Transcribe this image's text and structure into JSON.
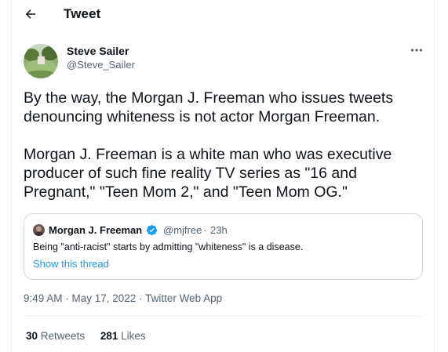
{
  "header": {
    "title": "Tweet",
    "back_icon": "arrow-left-icon"
  },
  "tweet": {
    "author": {
      "name": "Steve Sailer",
      "handle": "@Steve_Sailer",
      "avatar_icon": "avatar-image"
    },
    "more_icon": "more-options-icon",
    "paragraphs": [
      "By the way, the Morgan J. Freeman who issues tweets denouncing whiteness is not actor Morgan Freeman.",
      "Morgan J. Freeman is a white man who was executive producer of such fine reality TV series as \"16 and Pregnant,\" \"Teen Mom 2,\" and \"Teen Mom OG.\""
    ],
    "quoted": {
      "name": "Morgan J. Freeman",
      "handle": "@mjfree",
      "separator": "·",
      "time": "23h",
      "text": "Being \"anti-racist\" starts by admitting \"whiteness\" is a disease.",
      "show_thread": "Show this thread",
      "verified_icon": "verified-badge-icon"
    },
    "timestamp": "9:49 AM · May 17, 2022",
    "meta_separator": " · ",
    "source": "Twitter Web App",
    "stats": {
      "retweets_count": "30",
      "retweets_label": "Retweets",
      "likes_count": "281",
      "likes_label": "Likes"
    }
  },
  "colors": {
    "text": "#0f1419",
    "secondary": "#536471",
    "link": "#1d9bf0",
    "border": "#cfd9de",
    "divider": "#eff3f4"
  }
}
